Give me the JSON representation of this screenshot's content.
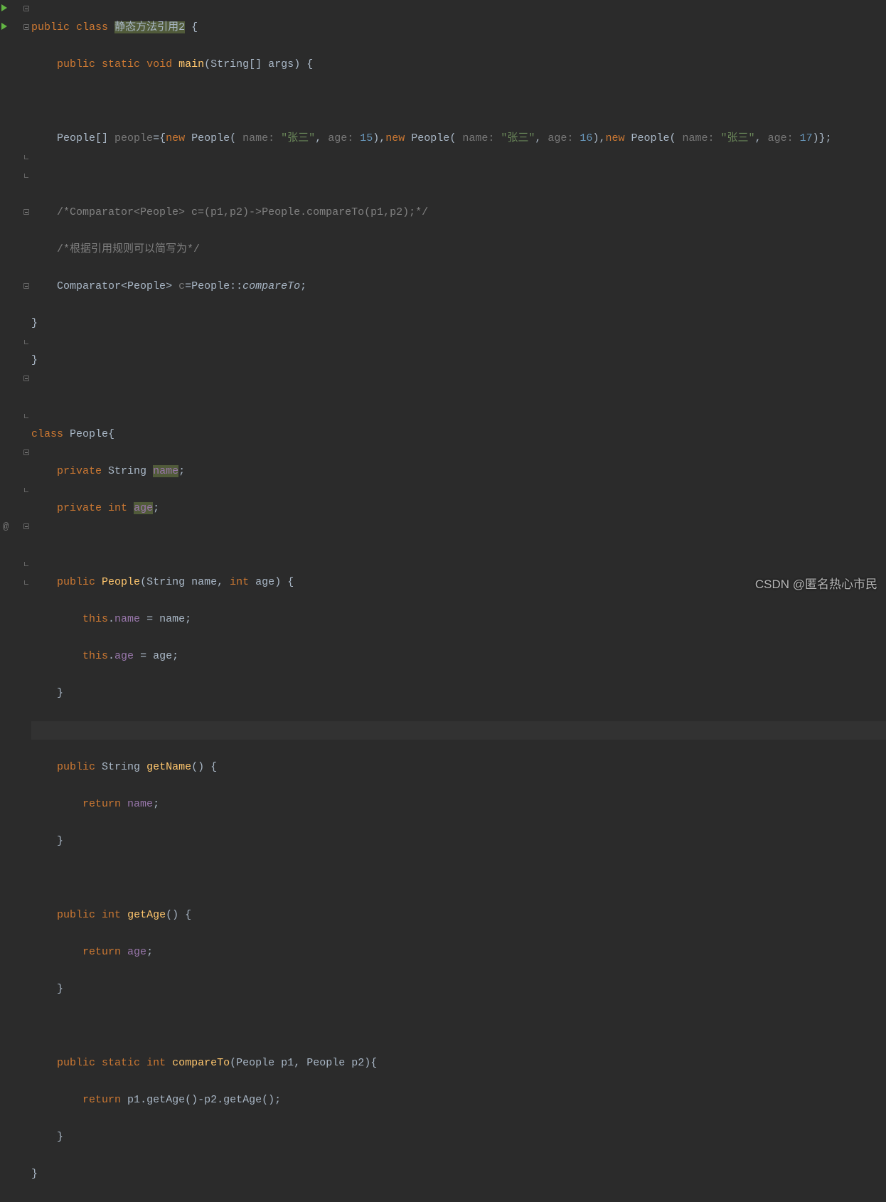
{
  "watermark": "CSDN @匿名热心市民",
  "tokens": {
    "public": "public",
    "class": "class",
    "static": "static",
    "void": "void",
    "new": "new",
    "private": "private",
    "int": "int",
    "this": "this",
    "return": "return",
    "className": "静态方法引用2",
    "main": "main",
    "String": "String",
    "args": "args",
    "People": "People",
    "peopleVar": "people",
    "nameHint": "name:",
    "ageHint": "age:",
    "zhangsan": "\"张三\"",
    "n15": "15",
    "n16": "16",
    "n17": "17",
    "cmt1": "/*Comparator<People> c=(p1,p2)->People.compareTo(p1,p2);*/",
    "cmt2": "/*根据引用规则可以简写为*/",
    "Comparator": "Comparator",
    "cVar": "c",
    "compareTo": "compareTo",
    "nameField": "name",
    "ageField": "age",
    "nameParam": "name",
    "ageParam": "age",
    "getName": "getName",
    "getAge": "getAge",
    "p1": "p1",
    "p2": "p2"
  }
}
